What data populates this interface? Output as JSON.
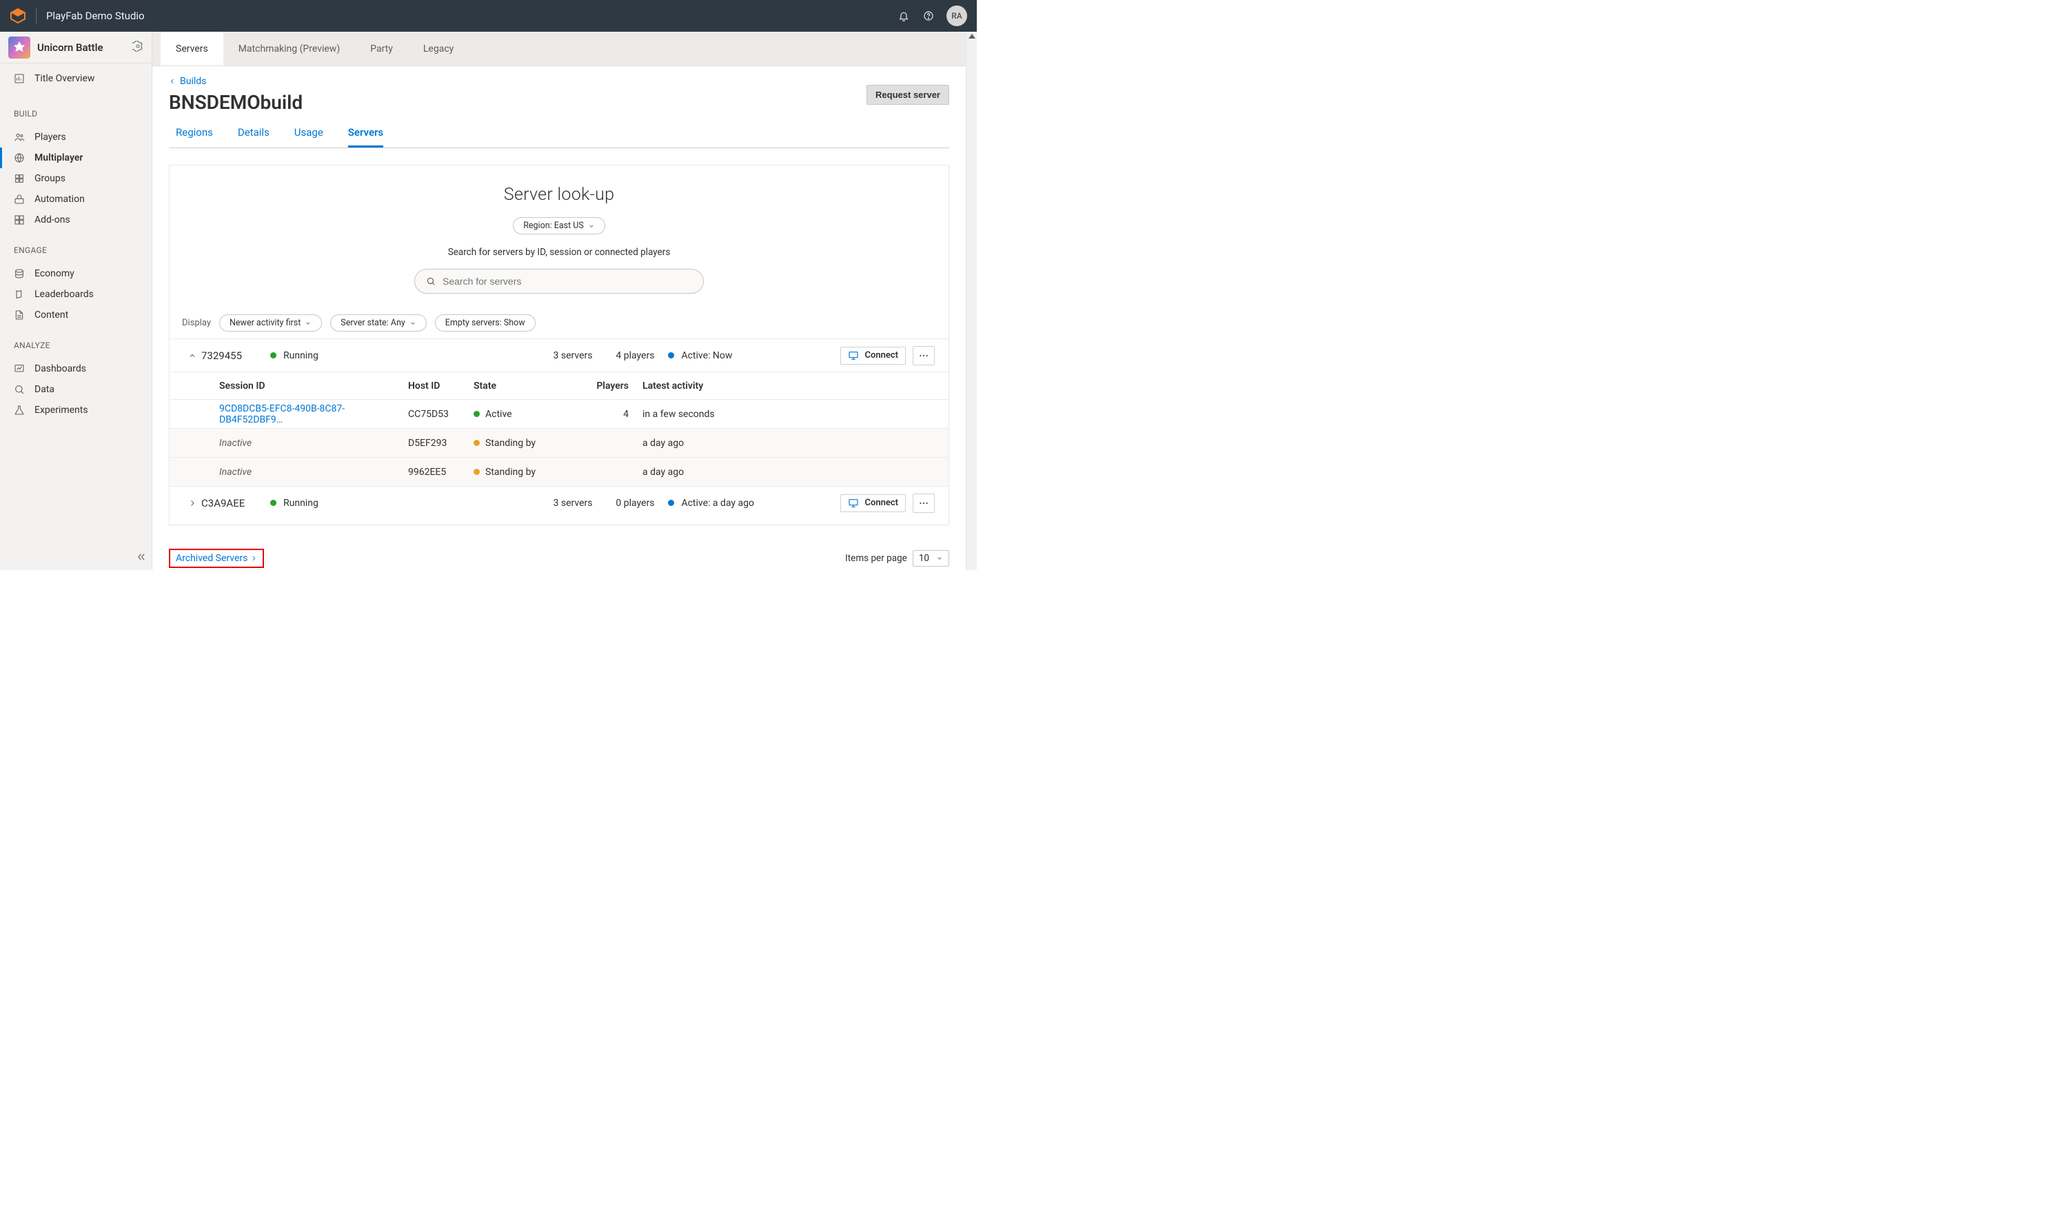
{
  "topbar": {
    "studio": "PlayFab Demo Studio",
    "avatar": "RA"
  },
  "app": {
    "name": "Unicorn Battle"
  },
  "sidebar": {
    "overview": "Title Overview",
    "groups": {
      "build": "BUILD",
      "engage": "ENGAGE",
      "analyze": "ANALYZE"
    },
    "build": [
      "Players",
      "Multiplayer",
      "Groups",
      "Automation",
      "Add-ons"
    ],
    "engage": [
      "Economy",
      "Leaderboards",
      "Content"
    ],
    "analyze": [
      "Dashboards",
      "Data",
      "Experiments"
    ]
  },
  "tabs": [
    "Servers",
    "Matchmaking (Preview)",
    "Party",
    "Legacy"
  ],
  "breadcrumb": "Builds",
  "title": "BNSDEMObuild",
  "request": "Request server",
  "subtabs": [
    "Regions",
    "Details",
    "Usage",
    "Servers"
  ],
  "panel": {
    "title": "Server look-up",
    "region": "Region: East US",
    "help": "Search for servers by ID, session or connected players",
    "placeholder": "Search for servers"
  },
  "filters": {
    "display": "Display",
    "sort": "Newer activity first",
    "state": "Server state: Any",
    "empty": "Empty servers: Show"
  },
  "cols": {
    "session": "Session ID",
    "host": "Host ID",
    "state": "State",
    "players": "Players",
    "latest": "Latest activity"
  },
  "vms": [
    {
      "id": "7329455",
      "state": "Running",
      "servers": "3 servers",
      "players": "4 players",
      "active": "Active: Now",
      "expanded": true,
      "sessions": [
        {
          "session": "9CD8DCB5-EFC8-490B-8C87-DB4F52DBF9…",
          "host": "CC75D53",
          "state": "Active",
          "dot": "green",
          "players": "4",
          "latest": "in a few seconds",
          "inactive": false
        },
        {
          "session": "Inactive",
          "host": "D5EF293",
          "state": "Standing by",
          "dot": "orange",
          "players": "",
          "latest": "a day ago",
          "inactive": true
        },
        {
          "session": "Inactive",
          "host": "9962EE5",
          "state": "Standing by",
          "dot": "orange",
          "players": "",
          "latest": "a day ago",
          "inactive": true
        }
      ]
    },
    {
      "id": "C3A9AEE",
      "state": "Running",
      "servers": "3 servers",
      "players": "0 players",
      "active": "Active: a day ago",
      "expanded": false
    }
  ],
  "connect": "Connect",
  "archived": "Archived Servers",
  "items_label": "Items per page",
  "items_value": "10"
}
